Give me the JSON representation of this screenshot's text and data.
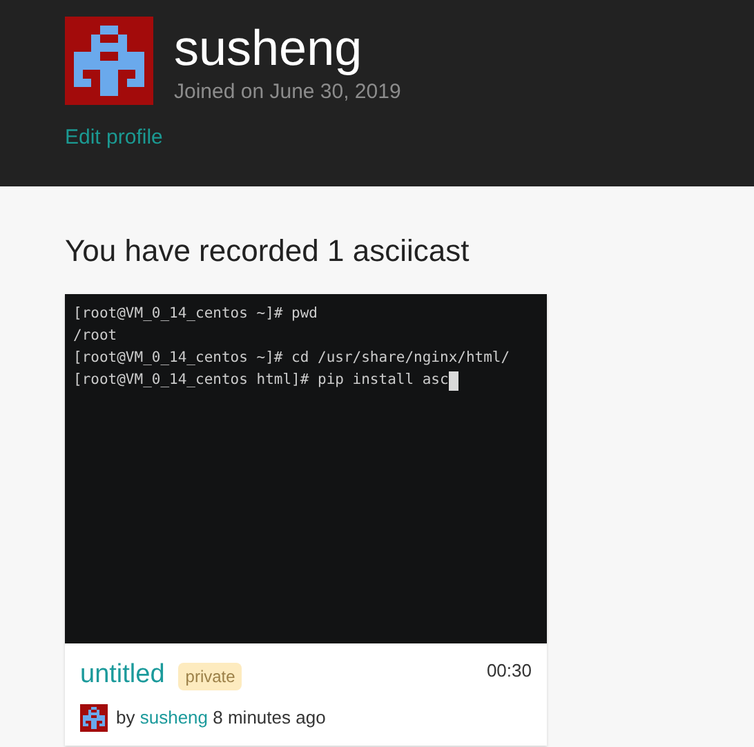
{
  "profile": {
    "username": "susheng",
    "joined": "Joined on June 30, 2019",
    "edit_link": "Edit profile"
  },
  "heading": "You have recorded 1 asciicast",
  "asciicasts": [
    {
      "terminal": {
        "lines": [
          "[root@VM_0_14_centos ~]# pwd",
          "/root",
          "[root@VM_0_14_centos ~]# cd /usr/share/nginx/html/",
          "[root@VM_0_14_centos html]# pip install asc"
        ],
        "cursor_visible": true
      },
      "title": "untitled",
      "badge": "private",
      "duration": "00:30",
      "by": "by",
      "author": "susheng",
      "time": "8 minutes ago"
    }
  ]
}
